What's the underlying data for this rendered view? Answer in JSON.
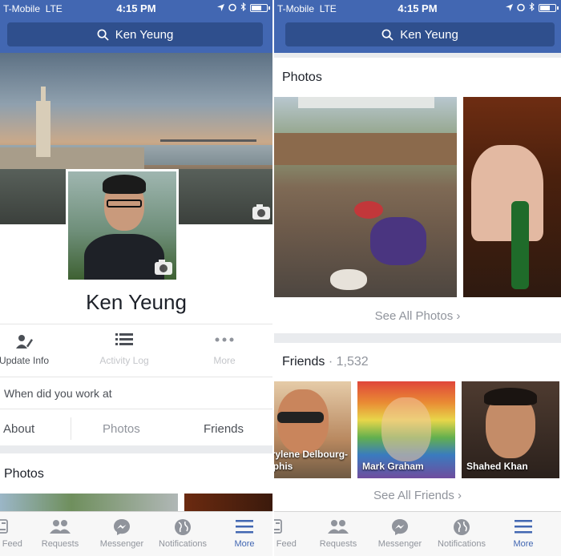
{
  "status_bar": {
    "carrier": "T-Mobile",
    "network": "LTE",
    "time": "4:15 PM"
  },
  "search": {
    "label": "Ken Yeung",
    "icon": "search-icon"
  },
  "profile": {
    "name": "Ken Yeung",
    "actions": [
      {
        "label": "Update Info",
        "icon": "edit-icon"
      },
      {
        "label": "Activity Log",
        "icon": "list-icon"
      },
      {
        "label": "More",
        "icon": "more-icon"
      }
    ],
    "composer_text": "When did you work at",
    "tabs": [
      "About",
      "Photos",
      "Friends"
    ]
  },
  "photos": {
    "title": "Photos",
    "see_all": "See All Photos"
  },
  "friends": {
    "title": "Friends",
    "count": "1,532",
    "see_all": "See All Friends",
    "items": [
      {
        "name_line1": "Marylene Delbourg-",
        "name_line2": "Delphis"
      },
      {
        "name_line1": "Mark Graham",
        "name_line2": ""
      },
      {
        "name_line1": "Shahed Khan",
        "name_line2": ""
      }
    ]
  },
  "tab_bar": [
    {
      "label": "News Feed",
      "icon": "news-feed-icon"
    },
    {
      "label": "Requests",
      "icon": "requests-icon"
    },
    {
      "label": "Messenger",
      "icon": "messenger-icon"
    },
    {
      "label": "Notifications",
      "icon": "globe-icon"
    },
    {
      "label": "More",
      "icon": "menu-icon",
      "active": true
    }
  ],
  "colors": {
    "brand": "#4267b2",
    "active_tab": "#4267b2"
  }
}
